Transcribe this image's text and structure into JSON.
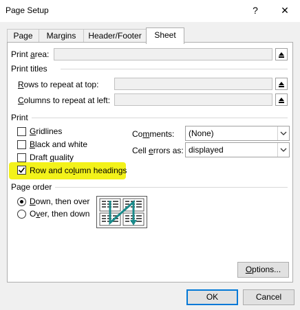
{
  "window": {
    "title": "Page Setup",
    "help_label": "?",
    "close_label": "✕"
  },
  "tabs": [
    {
      "label": "Page",
      "active": false
    },
    {
      "label": "Margins",
      "active": false
    },
    {
      "label": "Header/Footer",
      "active": false
    },
    {
      "label": "Sheet",
      "active": true
    }
  ],
  "print_area": {
    "label_pre": "Print ",
    "label_acc": "a",
    "label_post": "rea:",
    "value": ""
  },
  "print_titles": {
    "heading": "Print titles",
    "rows": {
      "label_acc": "R",
      "label_post": "ows to repeat at top:",
      "value": ""
    },
    "columns": {
      "label_acc": "C",
      "label_post": "olumns to repeat at left:",
      "value": ""
    }
  },
  "print": {
    "heading": "Print",
    "gridlines": {
      "label_acc": "G",
      "label_post": "ridlines",
      "checked": false
    },
    "black_white": {
      "label_acc": "B",
      "label_post": "lack and white",
      "checked": false
    },
    "draft": {
      "label_pre": "Draft ",
      "label_acc": "q",
      "label_post": "uality",
      "checked": false
    },
    "headings": {
      "label_pre": "Row and co",
      "label_acc": "l",
      "label_post": "umn headings",
      "checked": true
    },
    "comments": {
      "label_pre": "Co",
      "label_acc": "m",
      "label_post": "ments:",
      "value": "(None)"
    },
    "cell_errors": {
      "label_pre": "Cell ",
      "label_acc": "e",
      "label_post": "rrors as:",
      "value": "displayed"
    }
  },
  "page_order": {
    "heading": "Page order",
    "down_over": {
      "label_acc": "D",
      "label_post": "own, then over",
      "selected": true
    },
    "over_down": {
      "label_pre": "O",
      "label_acc": "v",
      "label_post": "er, then down",
      "selected": false
    }
  },
  "buttons": {
    "options": {
      "label_pre": "",
      "label_acc": "O",
      "label_post": "ptions..."
    },
    "ok": "OK",
    "cancel": "Cancel"
  },
  "colors": {
    "highlight": "#f3f21a",
    "preview_arrow": "#1a8a8a",
    "default_button_border": "#0078d7"
  }
}
